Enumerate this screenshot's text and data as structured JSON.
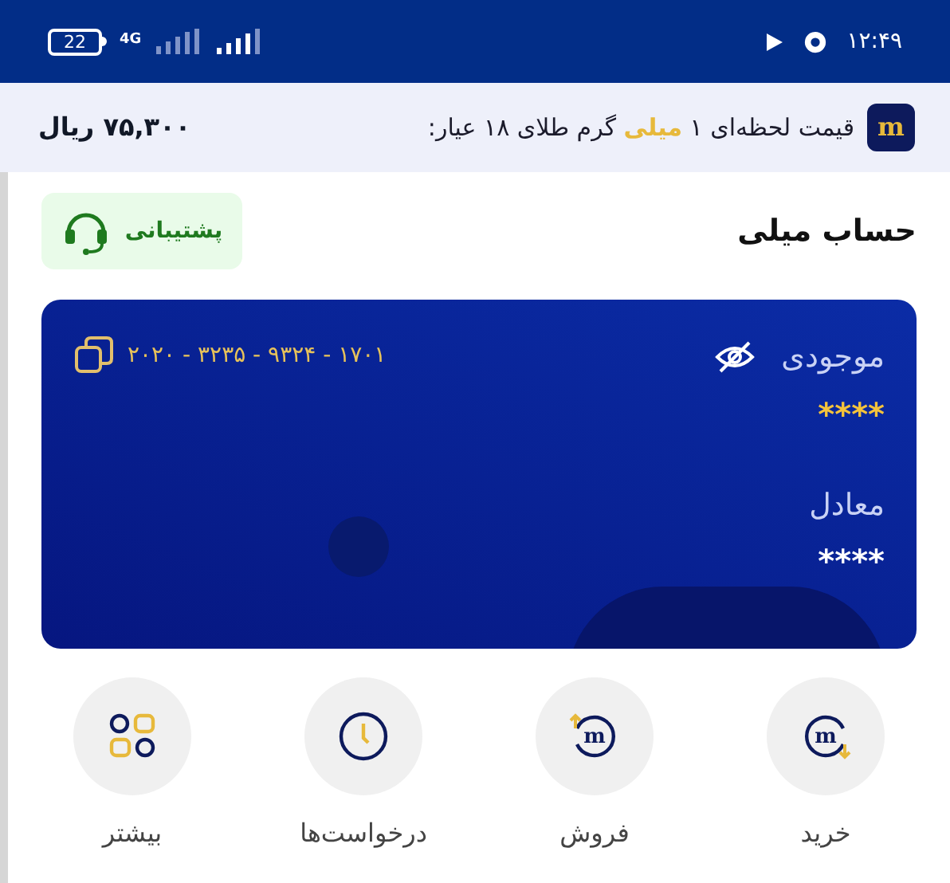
{
  "status_bar": {
    "time": "۱۲:۴۹",
    "battery": "22",
    "network": "4G"
  },
  "price_bar": {
    "logo_letter": "m",
    "segments": [
      {
        "text": "قیمت لحظه‌ای ۱ ",
        "highlight": false
      },
      {
        "text": "میلی",
        "highlight": true
      },
      {
        "text": " گرم طلای ۱۸ عیار:",
        "highlight": false
      }
    ],
    "price": "۷۵,۳۰۰ ریال"
  },
  "header": {
    "title": "حساب میلی",
    "support_button": "پشتیبانی"
  },
  "card": {
    "balance_label": "موجودی",
    "balance_value": "****",
    "equivalent_label": "معادل",
    "equivalent_value": "****",
    "account_number": "۲۰۲۰ - ۳۲۳۵ - ۹۳۲۴ - ۱۷۰۱"
  },
  "actions": [
    {
      "kind": "buy",
      "label": "خرید",
      "icon_letter": "m"
    },
    {
      "kind": "sell",
      "label": "فروش",
      "icon_letter": "m"
    },
    {
      "kind": "requests",
      "label": "درخواست‌ها"
    },
    {
      "kind": "more",
      "label": "بیشتر"
    }
  ]
}
